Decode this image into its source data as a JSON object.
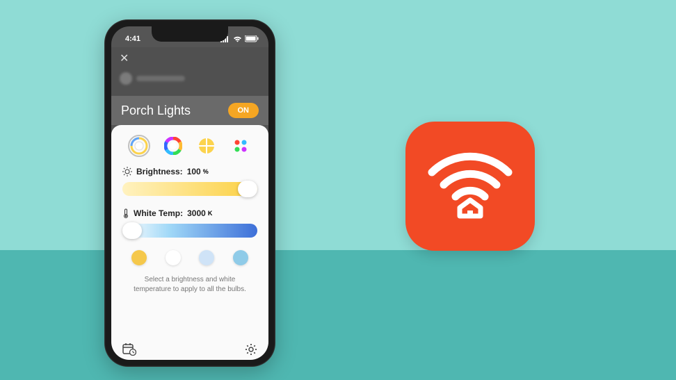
{
  "status": {
    "time": "4:41"
  },
  "header": {
    "title": "Porch Lights",
    "toggle_label": "ON"
  },
  "modes": {
    "items": [
      {
        "name": "white-temp",
        "selected": true
      },
      {
        "name": "color-wheel",
        "selected": false
      },
      {
        "name": "scenes",
        "selected": false
      },
      {
        "name": "presets-grid",
        "selected": false
      }
    ]
  },
  "brightness": {
    "label": "Brightness:",
    "value": "100",
    "unit": "%",
    "percent": 100
  },
  "white_temp": {
    "label": "White Temp:",
    "value": "3000",
    "unit": "K",
    "percent": 0
  },
  "presets": {
    "colors": [
      "#f5c84b",
      "#ffffff",
      "#cfe3f7",
      "#8fcbe8"
    ]
  },
  "help_text": "Select a brightness and white temperature to apply to all the bulbs.",
  "app_icon": {
    "name": "smart-home-app"
  }
}
